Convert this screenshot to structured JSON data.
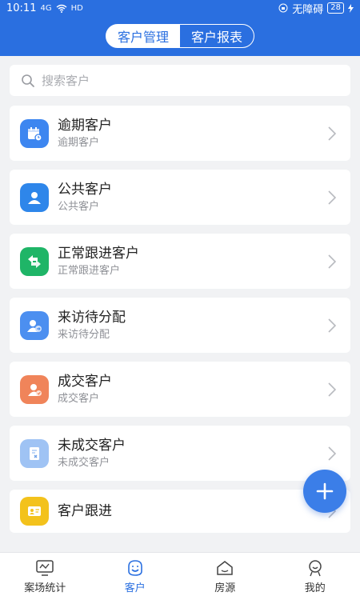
{
  "status_bar": {
    "time": "10:11",
    "signal": "4G",
    "network": "HD",
    "accessibility": "无障碍",
    "battery": "28"
  },
  "header": {
    "tabs": [
      {
        "label": "客户管理",
        "active": false
      },
      {
        "label": "客户报表",
        "active": true
      }
    ]
  },
  "search": {
    "placeholder": "搜索客户"
  },
  "items": [
    {
      "title": "逾期客户",
      "subtitle": "逾期客户",
      "icon": "calendar-icon",
      "color": "#3d86f0"
    },
    {
      "title": "公共客户",
      "subtitle": "公共客户",
      "icon": "person-icon",
      "color": "#2e86ea"
    },
    {
      "title": "正常跟进客户",
      "subtitle": "正常跟进客户",
      "icon": "swap-arrows-icon",
      "color": "#1fb567"
    },
    {
      "title": "来访待分配",
      "subtitle": "来访待分配",
      "icon": "user-assign-icon",
      "color": "#4c8ff0"
    },
    {
      "title": "成交客户",
      "subtitle": "成交客户",
      "icon": "user-deal-icon",
      "color": "#f0845a"
    },
    {
      "title": "未成交客户",
      "subtitle": "未成交客户",
      "icon": "document-x-icon",
      "color": "#9fc3f4"
    },
    {
      "title": "客户跟进",
      "subtitle": "",
      "icon": "id-card-icon",
      "color": "#f3c21c"
    }
  ],
  "bottom_nav": [
    {
      "label": "案场统计",
      "icon": "monitor-icon",
      "active": false
    },
    {
      "label": "客户",
      "icon": "smile-face-icon",
      "active": true
    },
    {
      "label": "房源",
      "icon": "house-icon",
      "active": false
    },
    {
      "label": "我的",
      "icon": "profile-icon",
      "active": false
    }
  ],
  "colors": {
    "primary": "#2a6fe0",
    "background": "#f1f2f4"
  }
}
